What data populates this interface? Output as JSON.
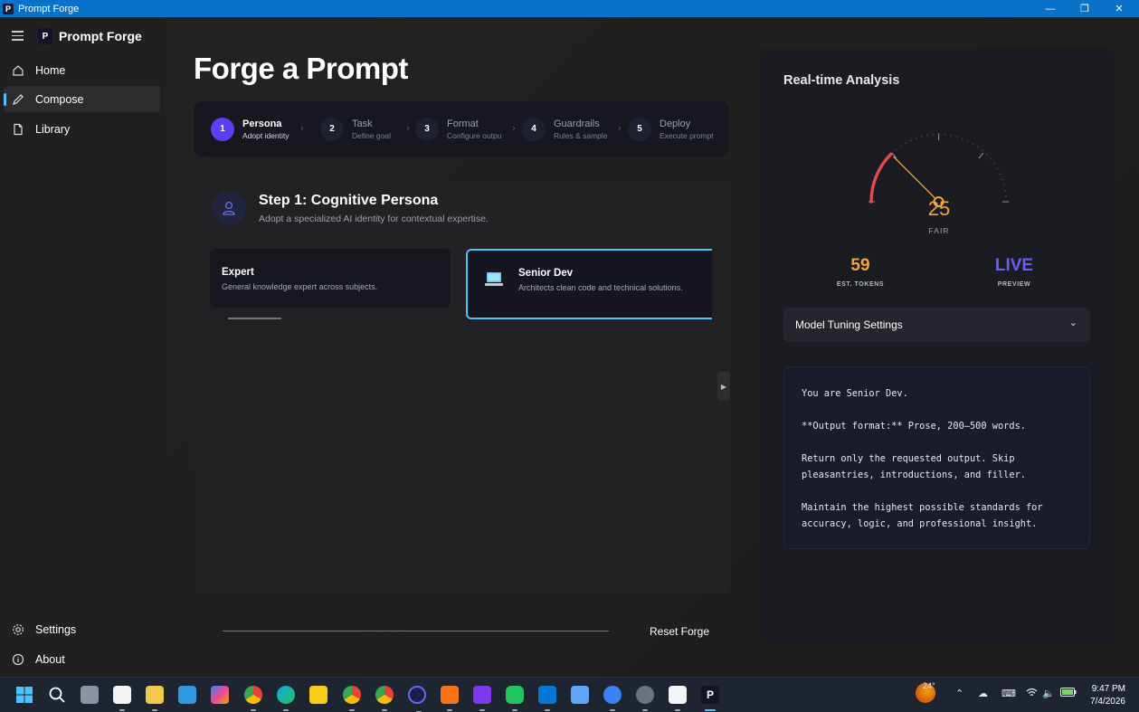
{
  "window": {
    "title": "Prompt Forge",
    "minimize_glyph": "—",
    "restore_glyph": "❐",
    "close_glyph": "✕"
  },
  "sidebar": {
    "brand": "Prompt Forge",
    "brand_logo_letter": "P",
    "items": [
      {
        "label": "Home",
        "icon": "home-icon"
      },
      {
        "label": "Compose",
        "icon": "pencil-icon",
        "active": true
      },
      {
        "label": "Library",
        "icon": "document-icon"
      }
    ],
    "footer_items": [
      {
        "label": "Settings",
        "icon": "gear-icon"
      },
      {
        "label": "About",
        "icon": "info-icon"
      }
    ]
  },
  "main": {
    "title": "Forge a Prompt",
    "steps": [
      {
        "num": "1",
        "title": "Persona",
        "sub": "Adopt identity",
        "active": true
      },
      {
        "num": "2",
        "title": "Task",
        "sub": "Define goal"
      },
      {
        "num": "3",
        "title": "Format",
        "sub": "Configure outpu"
      },
      {
        "num": "4",
        "title": "Guardrails",
        "sub": "Rules & sample"
      },
      {
        "num": "5",
        "title": "Deploy",
        "sub": "Execute prompt"
      }
    ],
    "panel": {
      "title": "Step 1: Cognitive Persona",
      "subtitle": "Adopt a specialized AI identity for contextual expertise.",
      "cards": [
        {
          "title": "Expert",
          "desc": "General knowledge expert across subjects."
        },
        {
          "title": "Senior Dev",
          "desc": "Architects clean code and technical solutions.",
          "selected": true
        }
      ],
      "scroll_arrow": "▶"
    },
    "reset_label": "Reset Forge"
  },
  "analysis": {
    "title": "Real-time Analysis",
    "gauge": {
      "value": "25",
      "label": "FAIR",
      "color": "#f0a63d",
      "fill_fraction": 0.25
    },
    "stats": [
      {
        "value": "59",
        "label": "EST. TOKENS",
        "color": "#f0a63d"
      },
      {
        "value": "LIVE",
        "label": "PREVIEW",
        "color": "#6b5cf5"
      }
    ],
    "tuning_label": "Model Tuning Settings",
    "tuning_chevron": "⌄",
    "preview_lines": [
      "You are Senior Dev.",
      "**Output format:** Prose, 200–500 words.",
      "Return only the requested output. Skip pleasantries, introductions, and filler.",
      "Maintain the highest possible standards for accuracy, logic, and professional insight."
    ]
  },
  "taskbar": {
    "weather": "24°",
    "time": "9:47 PM",
    "date": "7/4/2026"
  }
}
